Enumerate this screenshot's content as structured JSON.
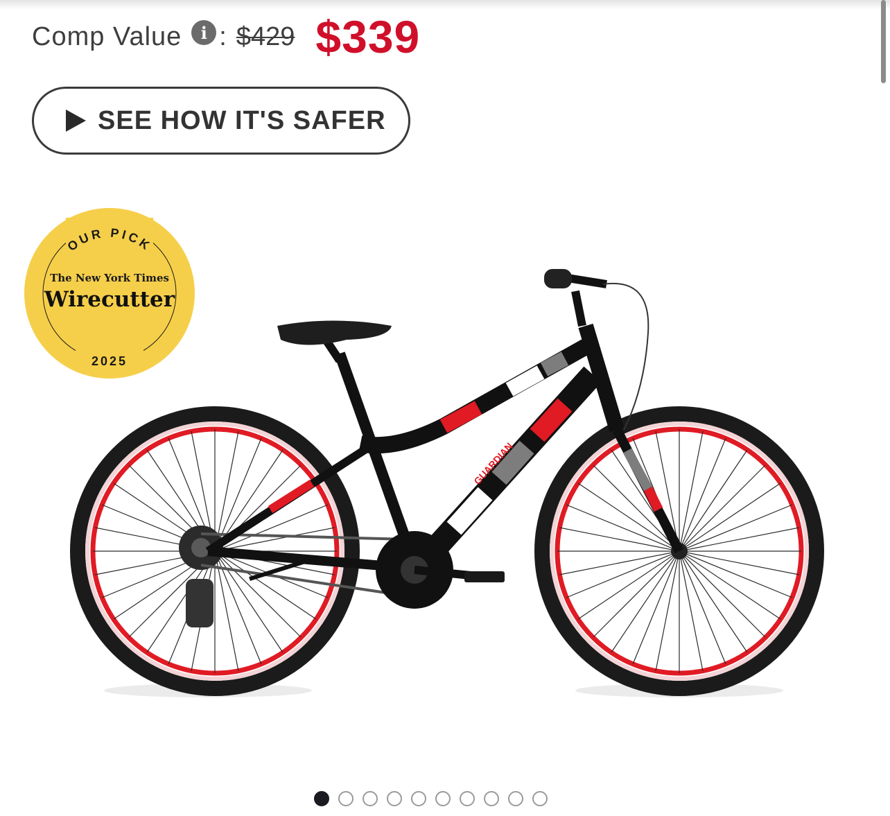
{
  "pricing": {
    "comp_label": "Comp Value",
    "info_icon": "info-icon",
    "colon": ":",
    "original_price": "$429",
    "sale_price": "$339",
    "sale_color": "#d0102a"
  },
  "safer_button": {
    "label": "SEE HOW IT'S SAFER",
    "icon": "play-icon"
  },
  "badge": {
    "top_text": "OUR PICK",
    "publisher": "The New York Times",
    "brand": "Wirecutter",
    "year": "2025",
    "color": "#f6cf4a"
  },
  "bike": {
    "brand_text": "GUARDIAN",
    "frame_colors": [
      "#111111",
      "#e01b24",
      "#ffffff",
      "#7d7d7d"
    ]
  },
  "carousel": {
    "total": 10,
    "active_index": 0
  }
}
